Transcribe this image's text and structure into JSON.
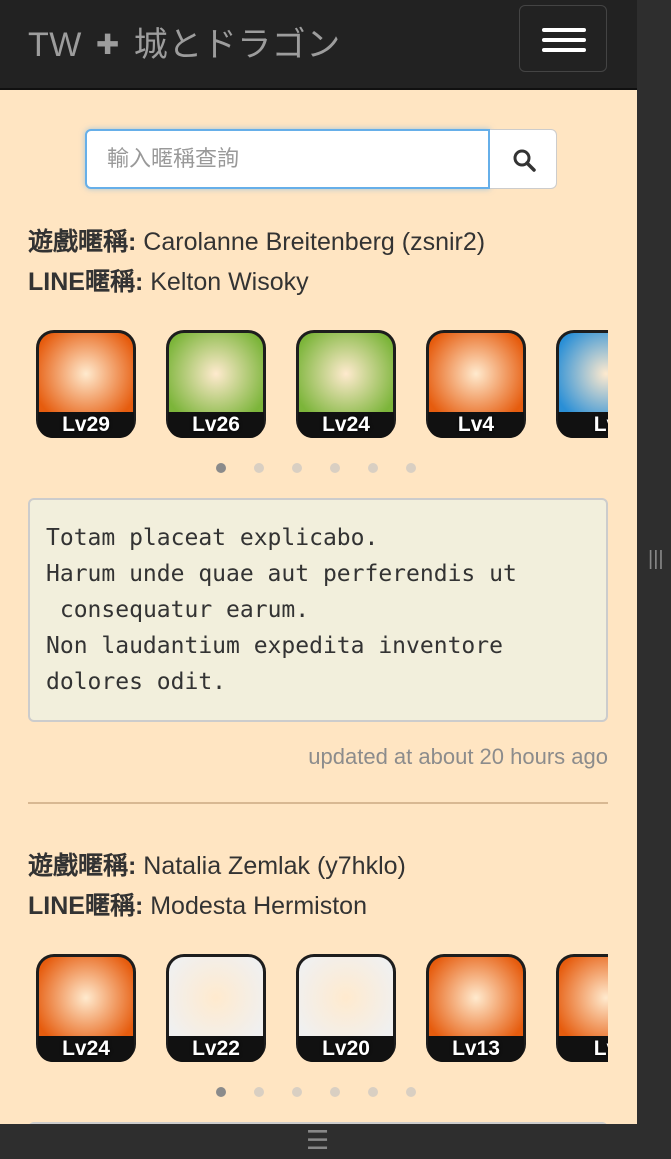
{
  "navbar": {
    "brand_left": "TW",
    "brand_cross": "✚",
    "brand_right": "城とドラゴン",
    "menu_icon": "hamburger-icon"
  },
  "search": {
    "placeholder": "輸入暱稱查詢",
    "icon": "search-icon"
  },
  "labels": {
    "game_nick": "遊戲暱稱:",
    "line_nick": "LINE暱稱:"
  },
  "entries": [
    {
      "game_name": "Carolanne Breitenberg (zsnir2)",
      "line_name": "Kelton Wisoky",
      "monsters": [
        {
          "level": "Lv29",
          "icon": "witch-mage-icon",
          "bg": "#e65c0e"
        },
        {
          "level": "Lv26",
          "icon": "lion-beast-icon",
          "bg": "#7cb53a"
        },
        {
          "level": "Lv24",
          "icon": "insect-demon-icon",
          "bg": "#7cb53a"
        },
        {
          "level": "Lv4",
          "icon": "medusa-icon",
          "bg": "#e65c0e"
        },
        {
          "level": "Lv",
          "icon": "blue-dragon-icon",
          "bg": "#2a8fd6"
        }
      ],
      "page_count": 6,
      "active_page": 0,
      "note": "Totam placeat explicabo.\nHarum unde quae aut perferendis ut\n consequatur earum.\nNon laudantium expedita inventore\ndolores odit.",
      "updated": "updated at about 20 hours ago"
    },
    {
      "game_name": "Natalia Zemlak (y7hklo)",
      "line_name": "Modesta Hermiston",
      "monsters": [
        {
          "level": "Lv24",
          "icon": "pink-rabbit-icon",
          "bg": "#e65c0e"
        },
        {
          "level": "Lv22",
          "icon": "white-sage-icon",
          "bg": "#f0f0f0"
        },
        {
          "level": "Lv20",
          "icon": "cat-girl-icon",
          "bg": "#f0f0f0"
        },
        {
          "level": "Lv13",
          "icon": "witch-mage-icon",
          "bg": "#e65c0e"
        },
        {
          "level": "Lv",
          "icon": "dark-warrior-icon",
          "bg": "#e65c0e"
        }
      ],
      "page_count": 6,
      "active_page": 0
    }
  ]
}
